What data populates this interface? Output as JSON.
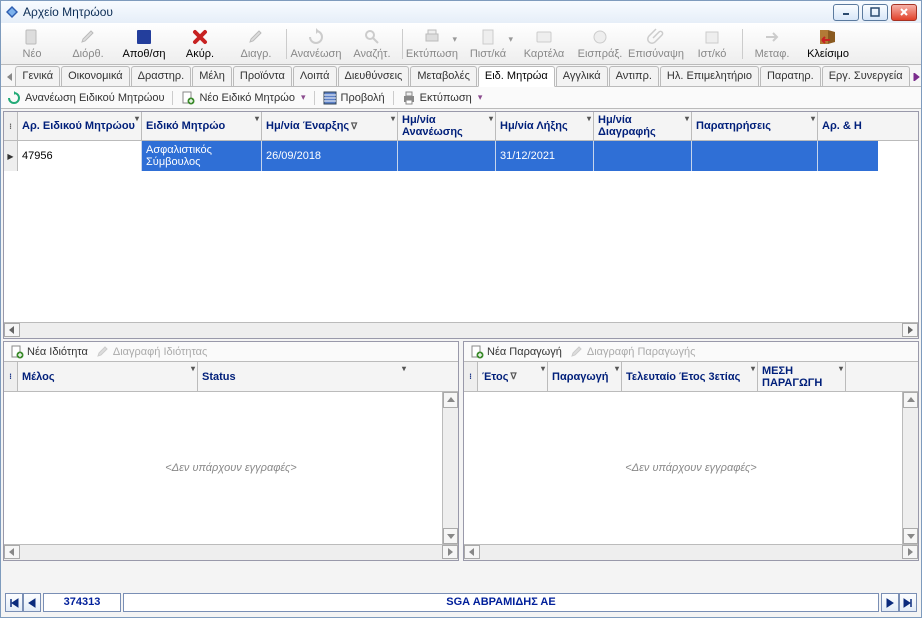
{
  "window": {
    "title": "Αρχείο Μητρώου"
  },
  "toolbar": {
    "new": "Νέο",
    "edit": "Διόρθ.",
    "save": "Αποθ/ση",
    "cancel": "Ακύρ.",
    "delete": "Διαγρ.",
    "refresh": "Ανανέωση",
    "search": "Αναζήτ.",
    "print": "Εκτύπωση",
    "cert": "Πιστ/κά",
    "card": "Καρτέλα",
    "collect": "Εισπράξ.",
    "attach": "Επισύναψη",
    "history": "Ιστ/κό",
    "transfer": "Μεταφ.",
    "close": "Κλείσιμο"
  },
  "tabs": [
    "Γενικά",
    "Οικονομικά",
    "Δραστηρ.",
    "Μέλη",
    "Προϊόντα",
    "Λοιπά",
    "Διευθύνσεις",
    "Μεταβολές",
    "Ειδ. Μητρώα",
    "Αγγλικά",
    "Αντιπρ.",
    "Ηλ. Επιμελητήριο",
    "Παρατηρ.",
    "Εργ. Συνεργεία"
  ],
  "active_tab_index": 8,
  "sub": {
    "refresh": "Ανανέωση Ειδικού Μητρώου",
    "new": "Νέο Ειδικό Μητρώο",
    "view": "Προβολή",
    "print": "Εκτύπωση"
  },
  "grid": {
    "cols": [
      "Αρ. Ειδικού Μητρώου",
      "Ειδικό Μητρώο",
      "Ημ/νία Έναρξης",
      "Ημ/νία Ανανέωσης",
      "Ημ/νία Λήξης",
      "Ημ/νία Διαγραφής",
      "Παρατηρήσεις",
      "Αρ. & Η"
    ],
    "rows": [
      {
        "id": "47956",
        "type": "Ασφαλιστικός Σύμβουλος",
        "start": "26/09/2018",
        "renew": "",
        "end": "31/12/2021",
        "del": "",
        "notes": "",
        "extra": ""
      }
    ]
  },
  "left_panel": {
    "new": "Νέα Ιδιότητα",
    "delete": "Διαγραφή Ιδιότητας",
    "cols": [
      "Μέλος",
      "Status"
    ],
    "empty": "<Δεν υπάρχουν εγγραφές>"
  },
  "right_panel": {
    "new": "Νέα Παραγωγή",
    "delete": "Διαγραφή Παραγωγής",
    "cols": [
      "Έτος",
      "Παραγωγή",
      "Τελευταίο Έτος 3ετίας",
      "ΜΕΣΗ ΠΑΡΑΓΩΓΗ"
    ],
    "empty": "<Δεν υπάρχουν εγγραφές>"
  },
  "status": {
    "id": "374313",
    "name": "SGA ΑΒΡΑΜΙΔΗΣ ΑΕ"
  }
}
